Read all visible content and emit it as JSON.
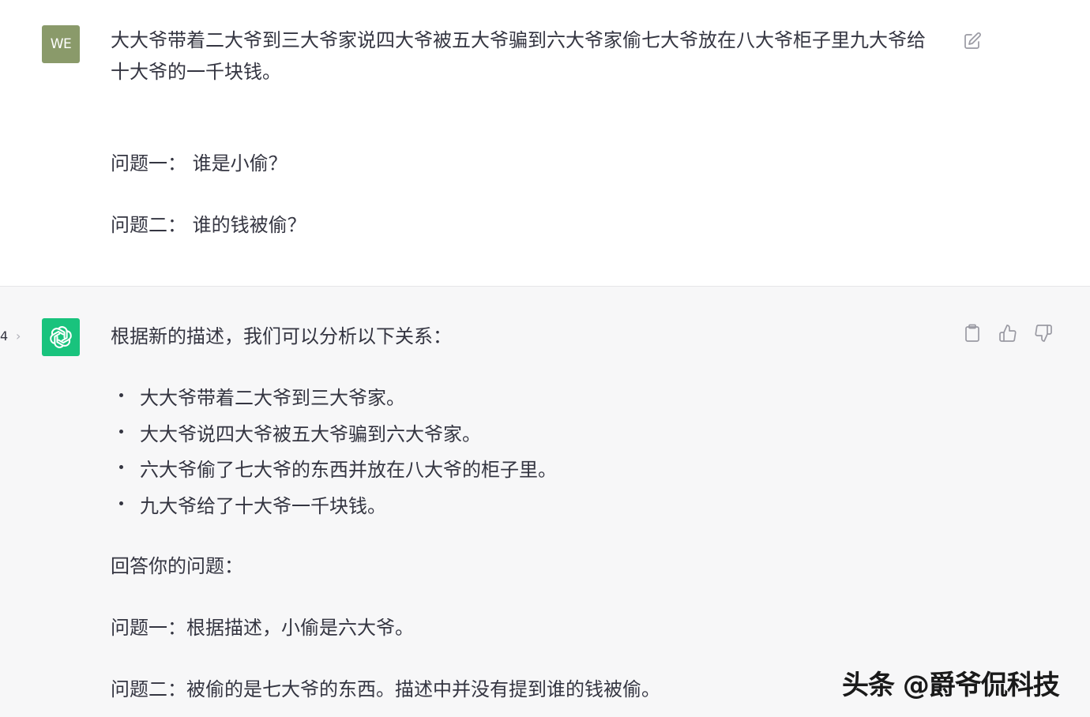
{
  "user_message": {
    "avatar_initials": "WE",
    "prompt": "大大爷带着二大爷到三大爷家说四大爷被五大爷骗到六大爷家偷七大爷放在八大爷柜子里九大爷给十大爷的一千块钱。",
    "question1": "问题一：  谁是小偷？",
    "question2": "问题二：  谁的钱被偷？",
    "edit_icon": "edit-icon"
  },
  "assistant_message": {
    "page_indicator": "4",
    "page_arrow": "›",
    "intro": "根据新的描述，我们可以分析以下关系：",
    "bullets": [
      "大大爷带着二大爷到三大爷家。",
      "大大爷说四大爷被五大爷骗到六大爷家。",
      "六大爷偷了七大爷的东西并放在八大爷的柜子里。",
      "九大爷给了十大爷一千块钱。"
    ],
    "answer_heading": "回答你的问题：",
    "answer1": "问题一：根据描述，小偷是六大爷。",
    "answer2": "问题二：被偷的是七大爷的东西。描述中并没有提到谁的钱被偷。",
    "icons": [
      "copy-icon",
      "thumbs-up-icon",
      "thumbs-down-icon"
    ]
  },
  "watermark": "头条 @爵爷侃科技",
  "colors": {
    "user_bg": "#ffffff",
    "assistant_bg": "#f7f7f8",
    "bot_avatar": "#19c37d",
    "user_avatar": "#8a9a6a",
    "text": "#343541",
    "icon": "#9a9aa3"
  }
}
